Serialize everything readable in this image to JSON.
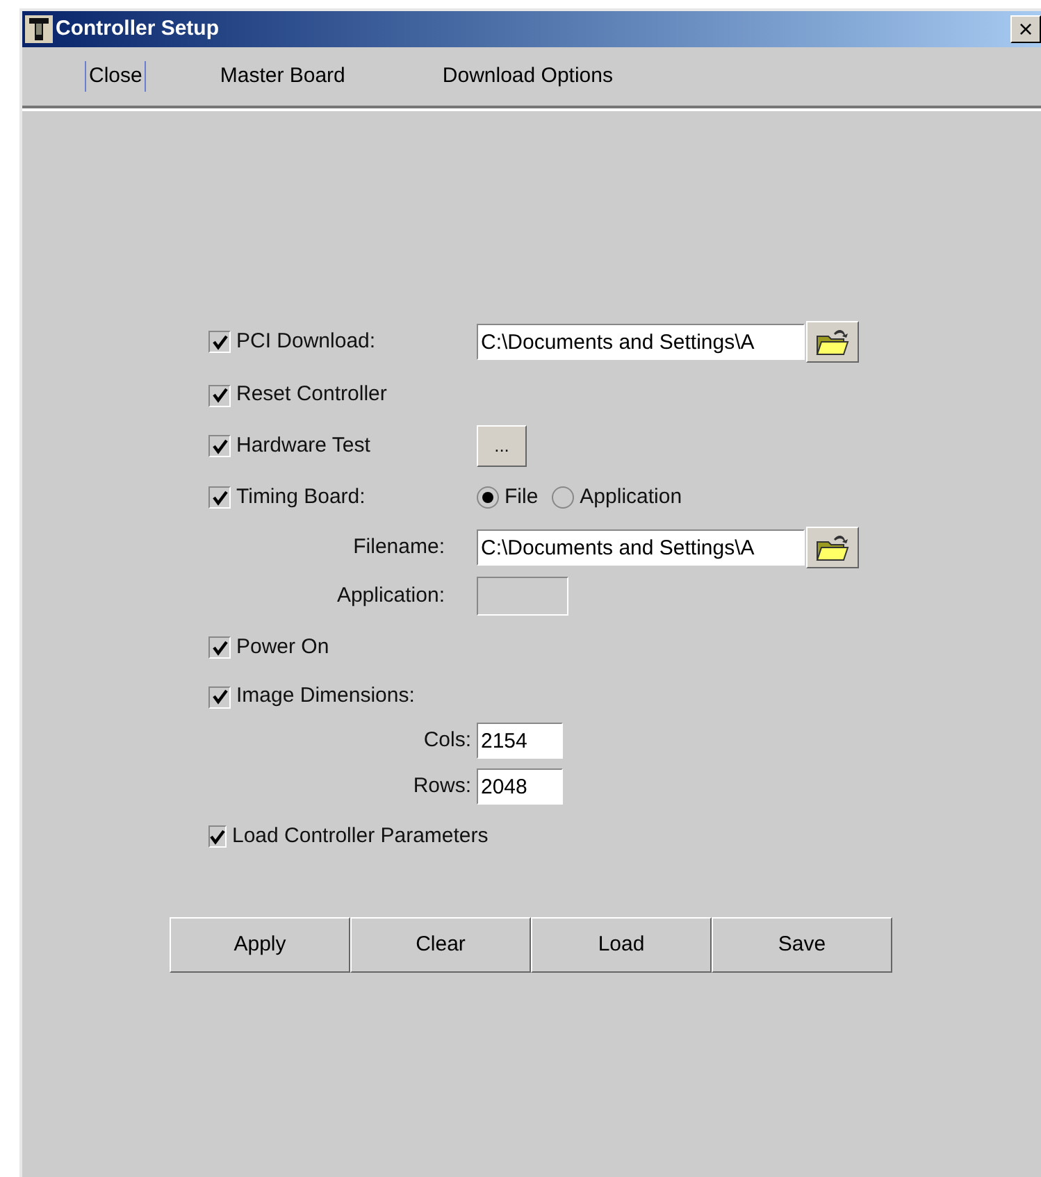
{
  "window": {
    "title": "Controller Setup",
    "close": "×"
  },
  "menu": [
    {
      "label": "Close",
      "focused": true
    },
    {
      "label": "Master Board",
      "focused": false
    },
    {
      "label": "Download Options",
      "focused": false
    }
  ],
  "options": [
    {
      "kind": "checkbox_path",
      "label": "PCI Download:",
      "checked": true,
      "value": "C:\\Documents and Settings\\A"
    },
    {
      "kind": "checkbox",
      "label": "Reset Controller",
      "checked": true
    },
    {
      "kind": "checkbox_button",
      "label": "Hardware Test",
      "checked": true,
      "button": "..."
    },
    {
      "kind": "checkbox_radio",
      "label": "Timing Board:",
      "checked": true,
      "choices": [
        {
          "label": "File",
          "selected": true
        },
        {
          "label": "Application",
          "selected": false
        }
      ]
    },
    {
      "kind": "path",
      "label": "Filename:",
      "value": "C:\\Documents and Settings\\A"
    },
    {
      "kind": "field",
      "label": "Application:",
      "disabled": true
    },
    {
      "kind": "checkbox",
      "label": "Power On",
      "checked": true
    },
    {
      "kind": "checkbox",
      "label": "Image Dimensions:",
      "checked": true
    },
    {
      "kind": "number",
      "label": "Cols:",
      "value": "2154"
    },
    {
      "kind": "number",
      "label": "Rows:",
      "value": "2048"
    },
    {
      "kind": "checkbox",
      "label": "Load Controller Parameters",
      "checked": true
    }
  ],
  "buttons": [
    "Apply",
    "Clear",
    "Load",
    "Save"
  ]
}
